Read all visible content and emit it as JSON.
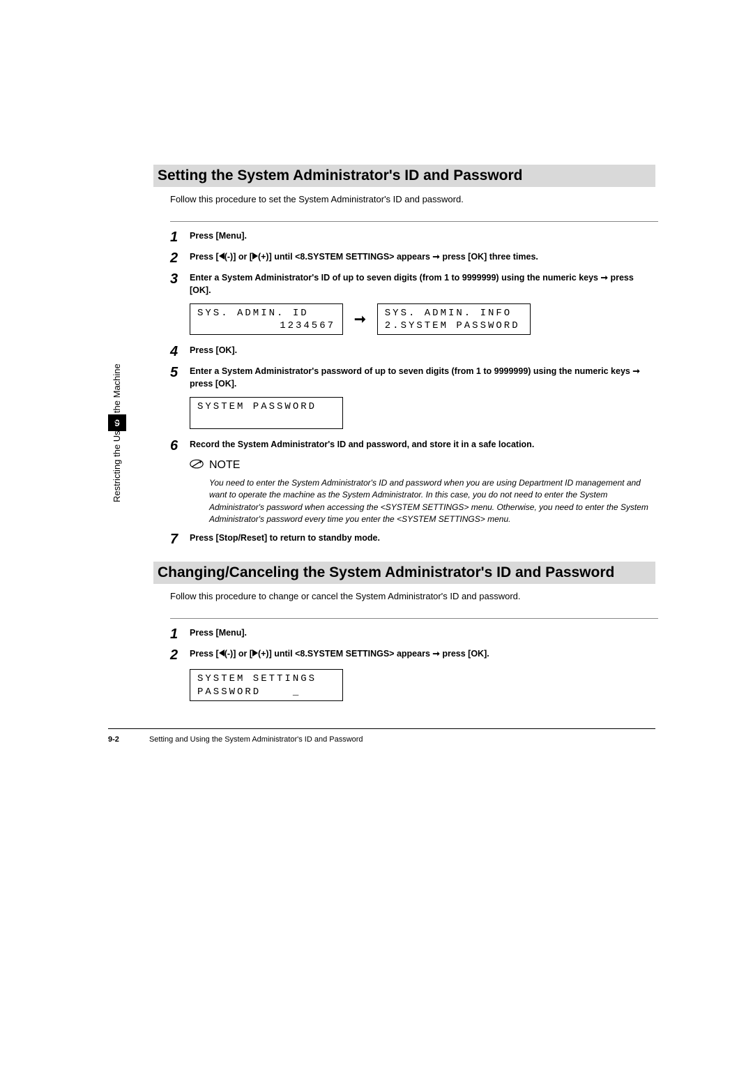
{
  "chapter": {
    "number": "9",
    "sideLabel": "Restricting the Use of the Machine"
  },
  "section1": {
    "title": "Setting the System Administrator's ID and Password",
    "intro": "Follow this procedure to set the System Administrator's ID and password.",
    "steps": {
      "s1": {
        "num": "1",
        "text": "Press [Menu]."
      },
      "s2": {
        "num": "2",
        "pre": "Press [",
        "mid1": "(-)] or [",
        "mid2": "(+)] until <8.SYSTEM SETTINGS> appears ",
        "post": " press [OK] three times."
      },
      "s3": {
        "num": "3",
        "pre": "Enter a System Administrator's ID of up to seven digits (from 1 to 9999999) using the numeric keys ",
        "post": " press [OK]."
      },
      "s4": {
        "num": "4",
        "text": "Press [OK]."
      },
      "s5": {
        "num": "5",
        "pre": "Enter a System Administrator's password of up to seven digits (from 1 to 9999999) using the numeric keys ",
        "post": " press [OK]."
      },
      "s6": {
        "num": "6",
        "text": "Record the System Administrator's ID and password, and store it in a safe location."
      },
      "s7": {
        "num": "7",
        "text": "Press [Stop/Reset] to return to standby mode."
      }
    },
    "lcd1a": {
      "line1": "SYS. ADMIN. ID",
      "line2": "1234567"
    },
    "lcd1b": {
      "line1": "SYS. ADMIN. INFO",
      "line2": "2.SYSTEM PASSWORD"
    },
    "lcd2": {
      "line1": "SYSTEM PASSWORD",
      "line2": " "
    },
    "noteLabel": "NOTE",
    "noteText": "You need to enter the System Administrator's ID and password when you are using Department ID management and want to operate the machine as the System Administrator. In this case, you do not need to enter the System Administrator's password when accessing the <SYSTEM SETTINGS> menu. Otherwise, you need to enter the System Administrator's password every time you enter the <SYSTEM SETTINGS> menu."
  },
  "section2": {
    "title": "Changing/Canceling the System Administrator's ID and Password",
    "intro": "Follow this procedure to change or cancel the System Administrator's ID and password.",
    "steps": {
      "s1": {
        "num": "1",
        "text": "Press [Menu]."
      },
      "s2": {
        "num": "2",
        "pre": "Press [",
        "mid1": "(-)] or [",
        "mid2": "(+)] until <8.SYSTEM SETTINGS> appears ",
        "post": " press [OK]."
      }
    },
    "lcd": {
      "line1": "SYSTEM SETTINGS",
      "line2": "PASSWORD    _"
    }
  },
  "arrowGlyph": "➞",
  "footer": {
    "page": "9-2",
    "title": "Setting and Using the System Administrator's ID and Password"
  }
}
